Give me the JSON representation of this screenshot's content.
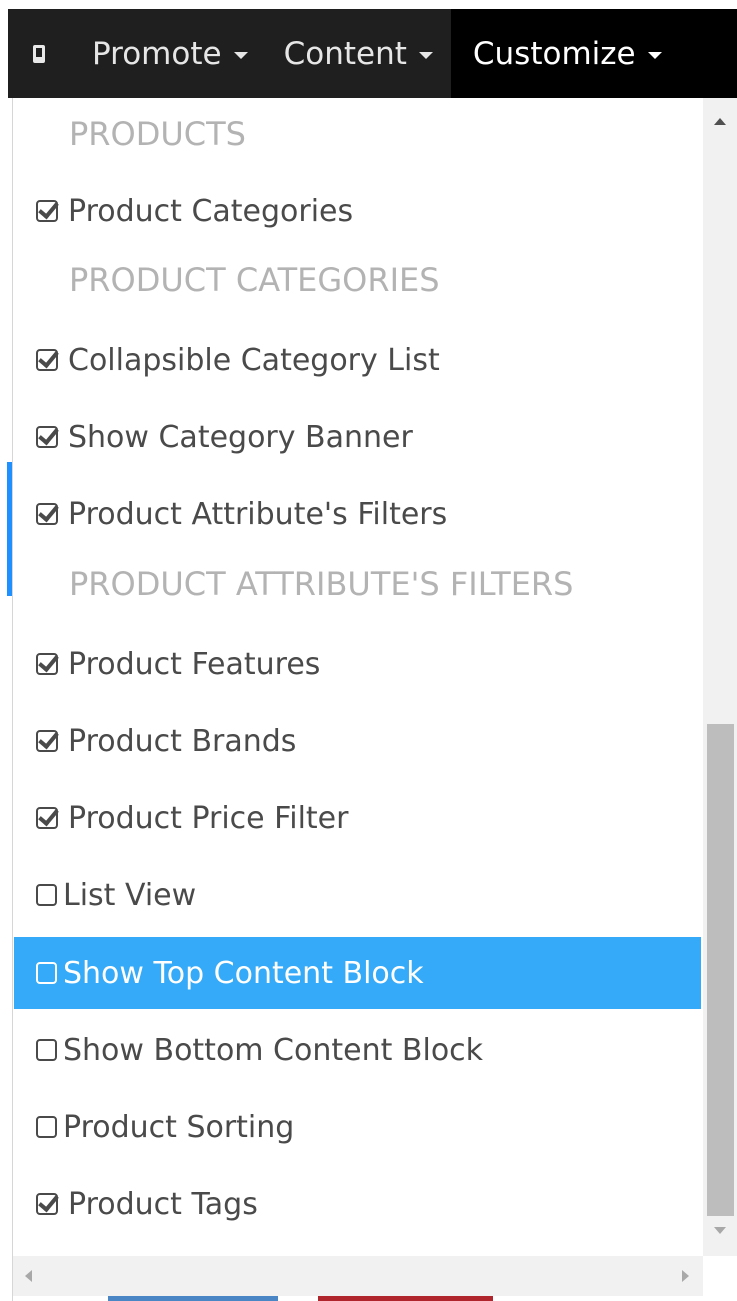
{
  "navbar": {
    "mobile_icon": "phone-icon",
    "items": [
      {
        "label": "Promote",
        "active": false
      },
      {
        "label": "Content",
        "active": false
      },
      {
        "label": "Customize",
        "active": true
      }
    ]
  },
  "dropdown": {
    "items": [
      {
        "type": "header",
        "label": "PRODUCTS"
      },
      {
        "type": "option",
        "label": "Product Categories",
        "checked": true
      },
      {
        "type": "header",
        "label": "PRODUCT CATEGORIES"
      },
      {
        "type": "option",
        "label": "Collapsible Category List",
        "checked": true
      },
      {
        "type": "option",
        "label": "Show Category Banner",
        "checked": true
      },
      {
        "type": "option",
        "label": "Product Attribute's Filters",
        "checked": true
      },
      {
        "type": "header",
        "label": "PRODUCT ATTRIBUTE'S FILTERS"
      },
      {
        "type": "option",
        "label": "Product Features",
        "checked": true
      },
      {
        "type": "option",
        "label": "Product Brands",
        "checked": true
      },
      {
        "type": "option",
        "label": "Product Price Filter",
        "checked": true
      },
      {
        "type": "option",
        "label": "List View",
        "checked": false
      },
      {
        "type": "option",
        "label": "Show Top Content Block",
        "checked": false,
        "highlighted": true
      },
      {
        "type": "option",
        "label": "Show Bottom Content Block",
        "checked": false
      },
      {
        "type": "option",
        "label": "Product Sorting",
        "checked": false
      },
      {
        "type": "option",
        "label": "Product Tags",
        "checked": true
      }
    ]
  },
  "colors": {
    "navbar_bg": "#1f1f1f",
    "navbar_active_bg": "#000000",
    "highlight": "#35aaf8",
    "header_text": "#b3b3b3",
    "item_text": "#4a4a4a"
  }
}
